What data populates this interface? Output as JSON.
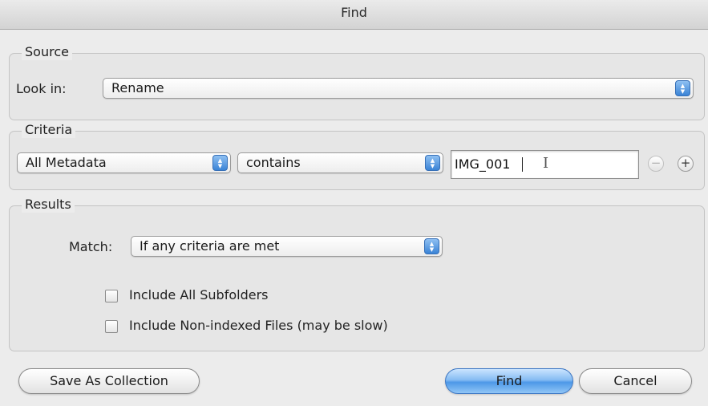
{
  "window": {
    "title": "Find"
  },
  "source": {
    "legend": "Source",
    "look_in_label": "Look in:",
    "look_in_value": "Rename"
  },
  "criteria": {
    "legend": "Criteria",
    "field_value": "All Metadata",
    "operator_value": "contains",
    "search_value": "IMG_001",
    "remove_icon": "minus-circle",
    "add_icon": "plus-circle"
  },
  "results": {
    "legend": "Results",
    "match_label": "Match:",
    "match_value": "If any criteria are met",
    "include_subfolders_label": "Include All Subfolders",
    "include_subfolders_checked": false,
    "include_nonindexed_label": "Include Non-indexed Files (may be slow)",
    "include_nonindexed_checked": false
  },
  "buttons": {
    "save_collection": "Save As Collection",
    "find": "Find",
    "cancel": "Cancel"
  },
  "colors": {
    "accent": "#4d98e8",
    "background": "#ececec"
  }
}
